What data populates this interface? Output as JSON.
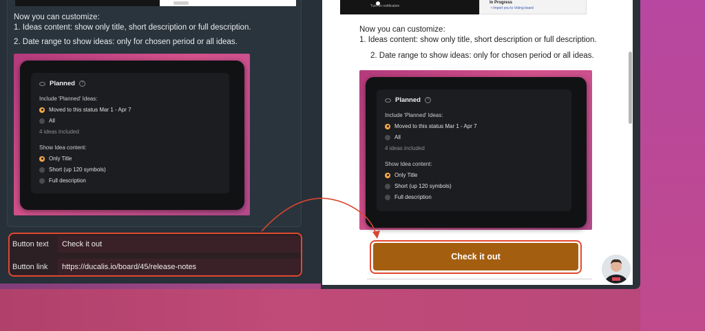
{
  "editor": {
    "intro": "Now you can customize:",
    "line1": "1. Ideas content: show only title, short description or full description.",
    "line2": "2.  Date range to show ideas: only for chosen period or all ideas.",
    "fields": {
      "button_text_label": "Button text",
      "button_text_value": "Check it out",
      "button_link_label": "Button link",
      "button_link_value": "https://ducalis.io/board/45/release-notes"
    }
  },
  "promo": {
    "title": "Planned",
    "help_icon": "?",
    "include_label": "Include 'Planned' Ideas:",
    "option_moved": "Moved to this status Mar 1 - Apr 7",
    "option_all": "All",
    "ideas_count": "4 ideas included",
    "content_label": "Show Idea content:",
    "content_only_title": "Only Title",
    "content_short": "Short (up 120 symbols)",
    "content_full": "Full description"
  },
  "preview": {
    "intro": "Now you can customize:",
    "line1": "1. Ideas content: show only title, short description or full description.",
    "line2": "2.  Date range to show ideas: only for chosen period or all ideas.",
    "cta_label": "Check it out",
    "thumb_left_label": "Turn on notification",
    "thumb_right_title": "In Progress",
    "thumb_right_link": "• Import you to Voting board"
  },
  "icons": {
    "eye": "eye-icon",
    "help": "help-icon",
    "arrow": "curved-arrow",
    "avatar": "user-avatar"
  },
  "colors": {
    "accent_red": "#e2472f",
    "cta_bg": "#a45e10",
    "radio_on": "#f0a445"
  }
}
